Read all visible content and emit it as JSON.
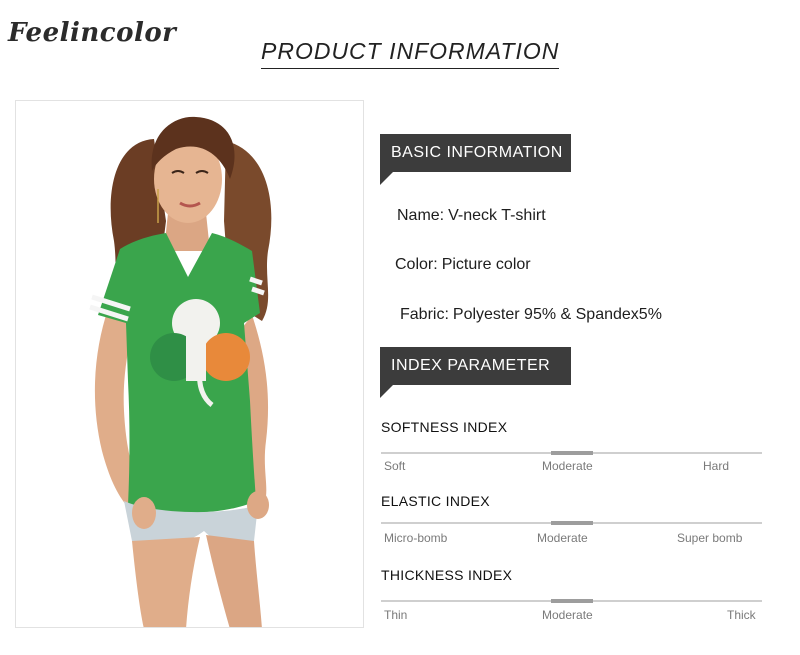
{
  "brand": {
    "name": "Feelincolor"
  },
  "header": {
    "title": "PRODUCT INFORMATION"
  },
  "sections": {
    "basic_title": "BASIC INFORMATION",
    "index_title": "INDEX PARAMETER"
  },
  "basic_info": {
    "name_label": "Name:",
    "name_value": "V-neck T-shirt",
    "color_label": "Color:",
    "color_value": "Picture color",
    "fabric_label": "Fabric:",
    "fabric_value": "Polyester 95% & Spandex5%"
  },
  "index_parameters": [
    {
      "title": "SOFTNESS INDEX",
      "labels": [
        "Soft",
        "Moderate",
        "Hard"
      ],
      "selected": "Moderate",
      "level": 0.5
    },
    {
      "title": "ELASTIC INDEX",
      "labels": [
        "Micro-bomb",
        "Moderate",
        "Super bomb"
      ],
      "selected": "Moderate",
      "level": 0.5
    },
    {
      "title": "THICKNESS INDEX",
      "labels": [
        "Thin",
        "Moderate",
        "Thick"
      ],
      "selected": "Moderate",
      "level": 0.5
    }
  ],
  "colors": {
    "tag_background": "#3c3c3c",
    "shirt_green": "#3aa54c",
    "track": "#cfcfcf",
    "marker": "#9d9d9d"
  }
}
